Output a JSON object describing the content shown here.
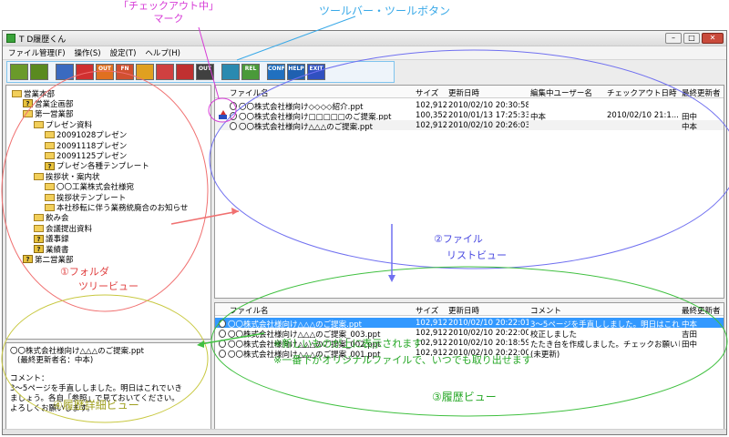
{
  "annotations": {
    "checkout_mark_line1": "「チェックアウト中」",
    "checkout_mark_line2": "マーク",
    "toolbar": "ツールバー・ツールボタン",
    "folder_tree_line1": "①フォルダ",
    "folder_tree_line2": "ツリービュー",
    "file_list_line1": "②ファイル",
    "file_list_line2": "リストビュー",
    "history_view": "③履歴ビュー",
    "history_detail": "④履歴詳細ビュー",
    "note_1": "※新しいものが上に表示されます",
    "note_2": "※一番下がオリジナルファイルで、いつでも取り出せます"
  },
  "window": {
    "title": "T D履歴くん",
    "menu": [
      "ファイル管理(F)",
      "操作(S)",
      "設定(T)",
      "ヘルプ(H)"
    ]
  },
  "toolbar": {
    "buttons": [
      {
        "label": "",
        "color": "#6a9a2a"
      },
      {
        "label": "",
        "color": "#5a8a20"
      },
      {
        "label": "",
        "color": "#3a6ac0"
      },
      {
        "label": "",
        "color": "#d03030"
      },
      {
        "label": "OUT",
        "color": "#e07020"
      },
      {
        "label": "FN",
        "color": "#d05030"
      },
      {
        "label": "",
        "color": "#e0a020"
      },
      {
        "label": "",
        "color": "#d04040"
      },
      {
        "label": "",
        "color": "#c03030"
      },
      {
        "label": "OUT",
        "color": "#404040"
      },
      {
        "label": "",
        "color": "#2a8ab0"
      },
      {
        "label": "REL",
        "color": "#4a9a3a"
      },
      {
        "label": "CONFIG",
        "color": "#2070c0"
      },
      {
        "label": "HELP",
        "color": "#2060b0"
      },
      {
        "label": "EXIT",
        "color": "#3050c0"
      }
    ]
  },
  "tree": [
    {
      "label": "営業本部",
      "level": 0,
      "icon": "folder"
    },
    {
      "label": "営業企画部",
      "level": 1,
      "icon": "qfolder"
    },
    {
      "label": "第一営業部",
      "level": 1,
      "icon": "folder"
    },
    {
      "label": "プレゼン資料",
      "level": 2,
      "icon": "folder"
    },
    {
      "label": "20091028プレゼン",
      "level": 3,
      "icon": "folder"
    },
    {
      "label": "20091118プレゼン",
      "level": 3,
      "icon": "folder"
    },
    {
      "label": "20091125プレゼン",
      "level": 3,
      "icon": "folder"
    },
    {
      "label": "プレゼン各種テンプレート",
      "level": 3,
      "icon": "qfolder"
    },
    {
      "label": "挨拶状・案内状",
      "level": 2,
      "icon": "folder"
    },
    {
      "label": "〇〇工業株式会社様宛",
      "level": 3,
      "icon": "folder"
    },
    {
      "label": "挨拶状テンプレート",
      "level": 3,
      "icon": "folder"
    },
    {
      "label": "本社移転に伴う業務統廃合のお知らせ",
      "level": 3,
      "icon": "folder"
    },
    {
      "label": "飲み会",
      "level": 2,
      "icon": "folder"
    },
    {
      "label": "会議提出資料",
      "level": 2,
      "icon": "folder"
    },
    {
      "label": "議事録",
      "level": 2,
      "icon": "qfolder"
    },
    {
      "label": "業績書",
      "level": 2,
      "icon": "qfolder"
    },
    {
      "label": "第二営業部",
      "level": 1,
      "icon": "qfolder"
    }
  ],
  "file_list": {
    "headers": [
      "ファイル名",
      "サイズ",
      "更新日時",
      "編集中ユーザー名",
      "チェックアウト日時",
      "最終更新者"
    ],
    "rows": [
      {
        "name": "〇〇株式会社様向け◇◇◇◇紹介.ppt",
        "size": "102,912",
        "updated": "2010/02/10 20:30:58",
        "editor": "",
        "checkout": "",
        "last": "",
        "checked_out": false
      },
      {
        "name": "〇〇株式会社様向け□□□□□のご提案.ppt",
        "size": "100,352",
        "updated": "2010/01/13 17:25:33",
        "editor": "中本",
        "checkout": "2010/02/10 21:1...",
        "last": "田中",
        "checked_out": true
      },
      {
        "name": "〇〇株式会社様向け△△△のご提案.ppt",
        "size": "102,912",
        "updated": "2010/02/10 20:26:03",
        "editor": "",
        "checkout": "",
        "last": "中本",
        "checked_out": false
      }
    ]
  },
  "history": {
    "headers": [
      "ファイル名",
      "サイズ",
      "更新日時",
      "コメント",
      "最終更新者"
    ],
    "rows": [
      {
        "name": "〇〇株式会社様向け△△△のご提案.ppt",
        "size": "102,912",
        "updated": "2010/02/10 20:22:01",
        "comment": "3～5ページを手直ししました。明日はこれ...",
        "last": "中本",
        "selected": true
      },
      {
        "name": "〇〇株式会社様向け△△△のご提案_003.ppt",
        "size": "102,912",
        "updated": "2010/02/10 20:22:00",
        "comment": "校正しました",
        "last": "吉田",
        "selected": false
      },
      {
        "name": "〇〇株式会社様向け△△△のご提案_002.ppt",
        "size": "102,912",
        "updated": "2010/02/10 20:18:59",
        "comment": "たたき台を作成しました。チェックお願いし...",
        "last": "田中",
        "selected": false
      },
      {
        "name": "〇〇株式会社様向け△△△のご提案_001.ppt",
        "size": "102,912",
        "updated": "2010/02/10 20:22:00",
        "comment": "(未更新)",
        "last": "",
        "selected": false
      }
    ]
  },
  "detail": {
    "title": "〇〇株式会社様向け△△△のご提案.ppt",
    "last_updater": "(最終更新者名：中本)",
    "comment_label": "コメント：",
    "comment_lines": [
      "3～5ページを手直ししました。明日はこれでいき",
      "ましょう。各自「参照」で見ておいてください。",
      "よろしくお願いします。"
    ]
  }
}
